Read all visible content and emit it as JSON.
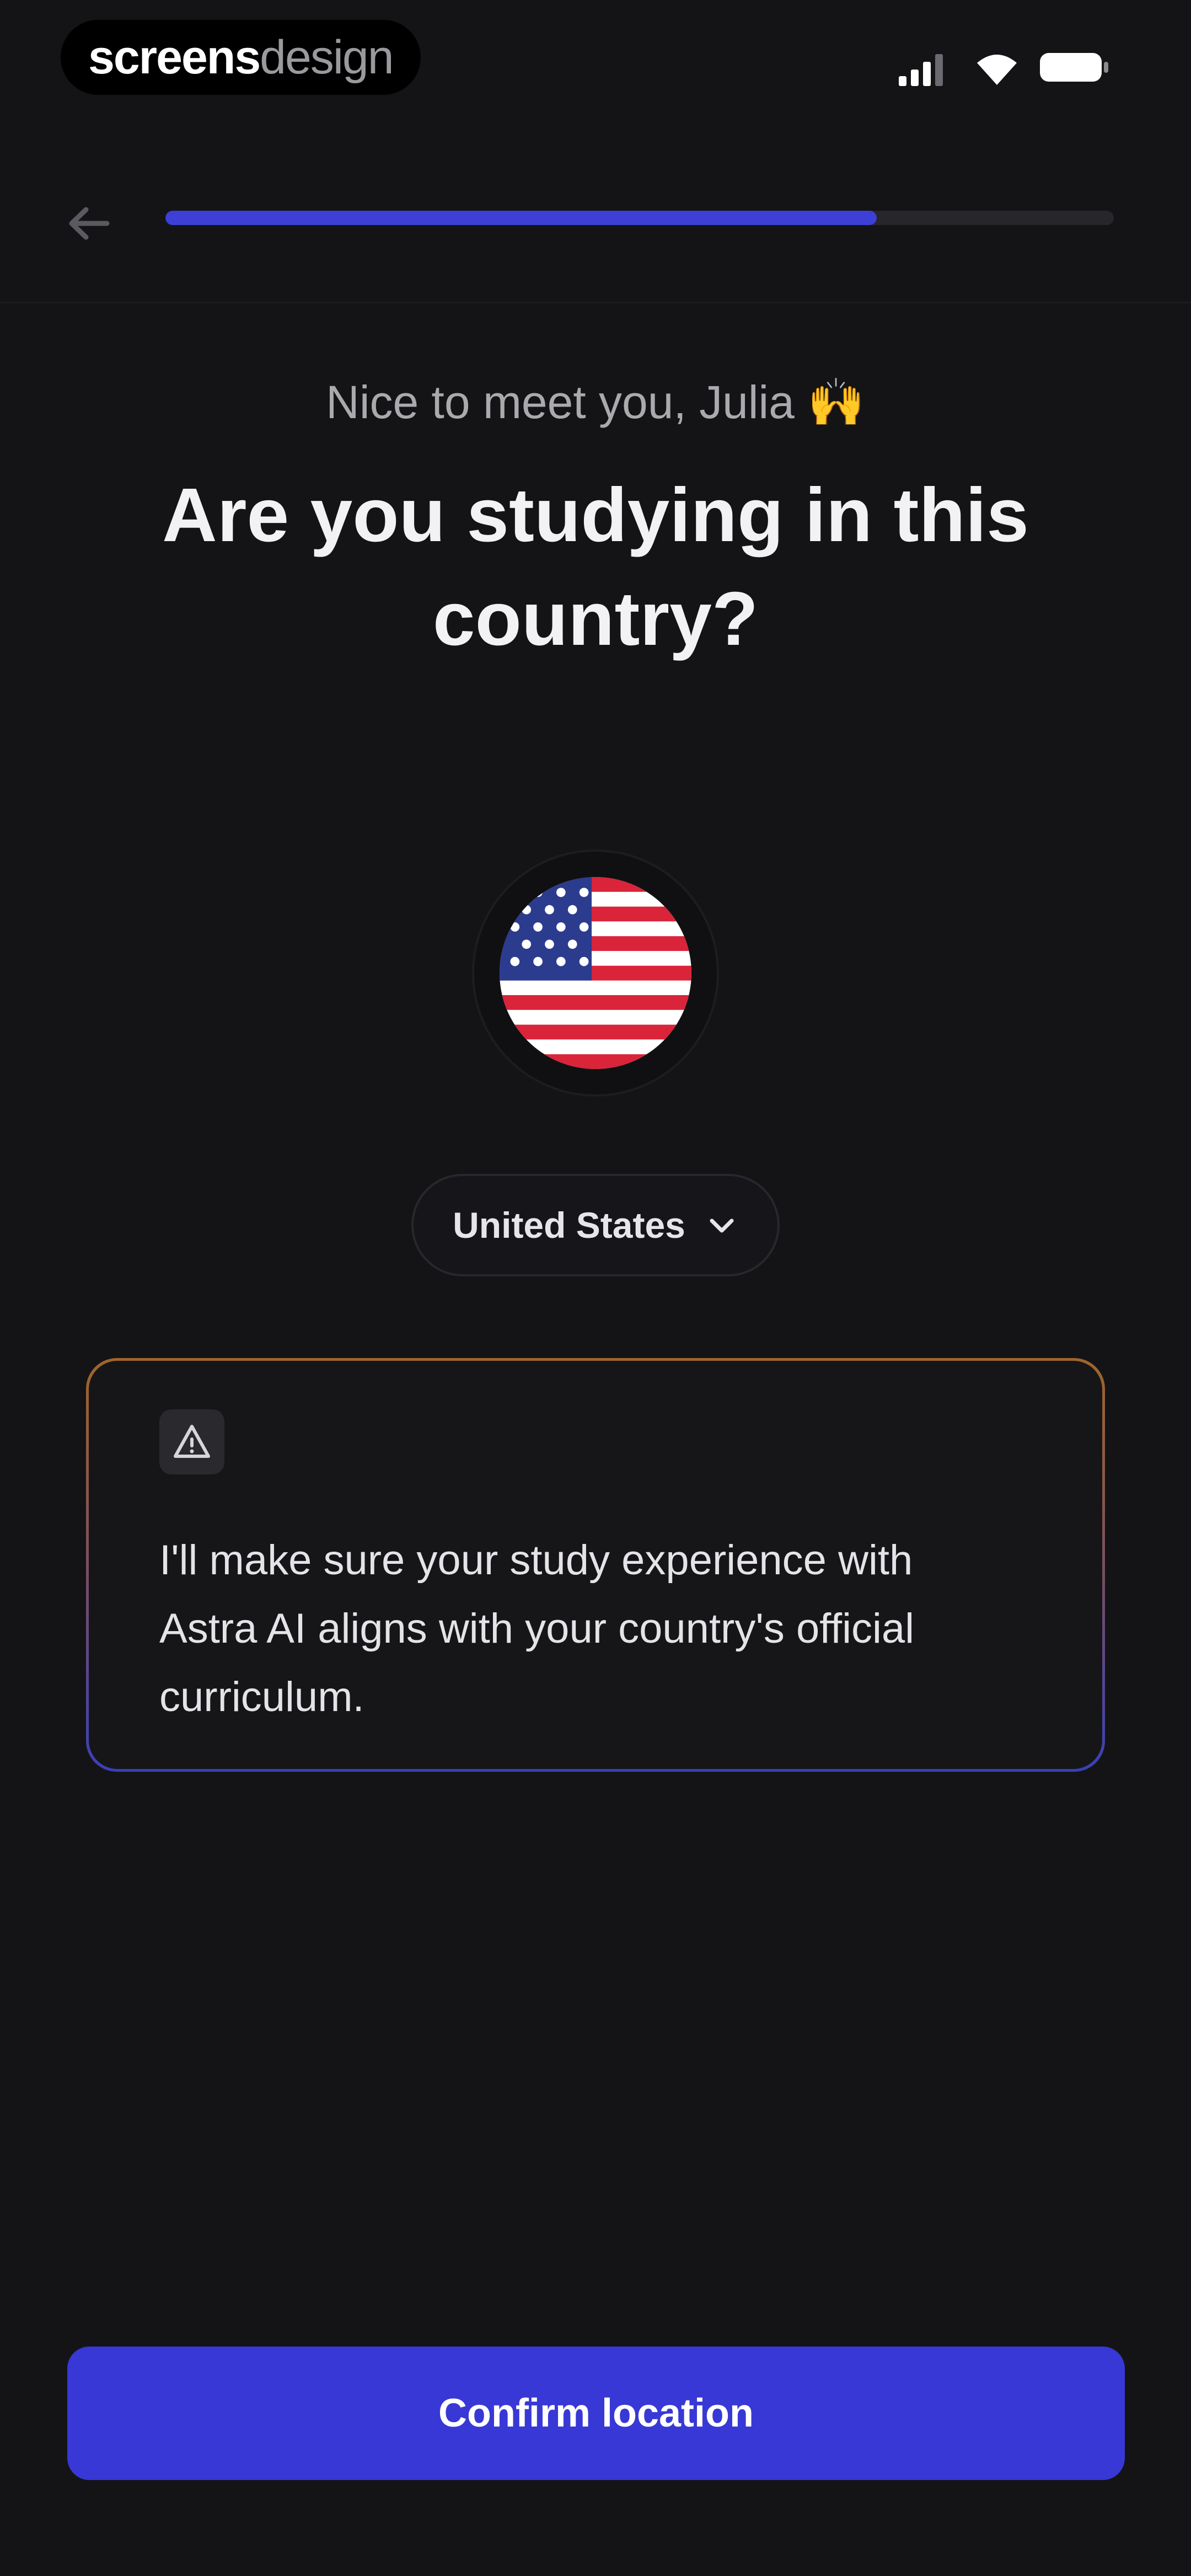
{
  "status_bar": {
    "watermark_bold": "screens",
    "watermark_light": "design",
    "icons": [
      "signal-icon",
      "wifi-icon",
      "battery-icon"
    ]
  },
  "nav": {
    "back_icon": "arrow-left-icon",
    "progress": 0.75,
    "progress_color": "#3d3fd6"
  },
  "header": {
    "greeting": "Nice to meet you, Julia 🙌",
    "title": "Are you studying in this country?"
  },
  "country": {
    "flag_icon": "us-flag-icon",
    "selected": "United States",
    "chevron_icon": "chevron-down-icon"
  },
  "info_card": {
    "icon": "warning-icon",
    "text": "I'll make sure your study experience with Astra AI aligns with your country's official curriculum."
  },
  "cta": {
    "label": "Confirm location",
    "color": "#3838d6"
  }
}
